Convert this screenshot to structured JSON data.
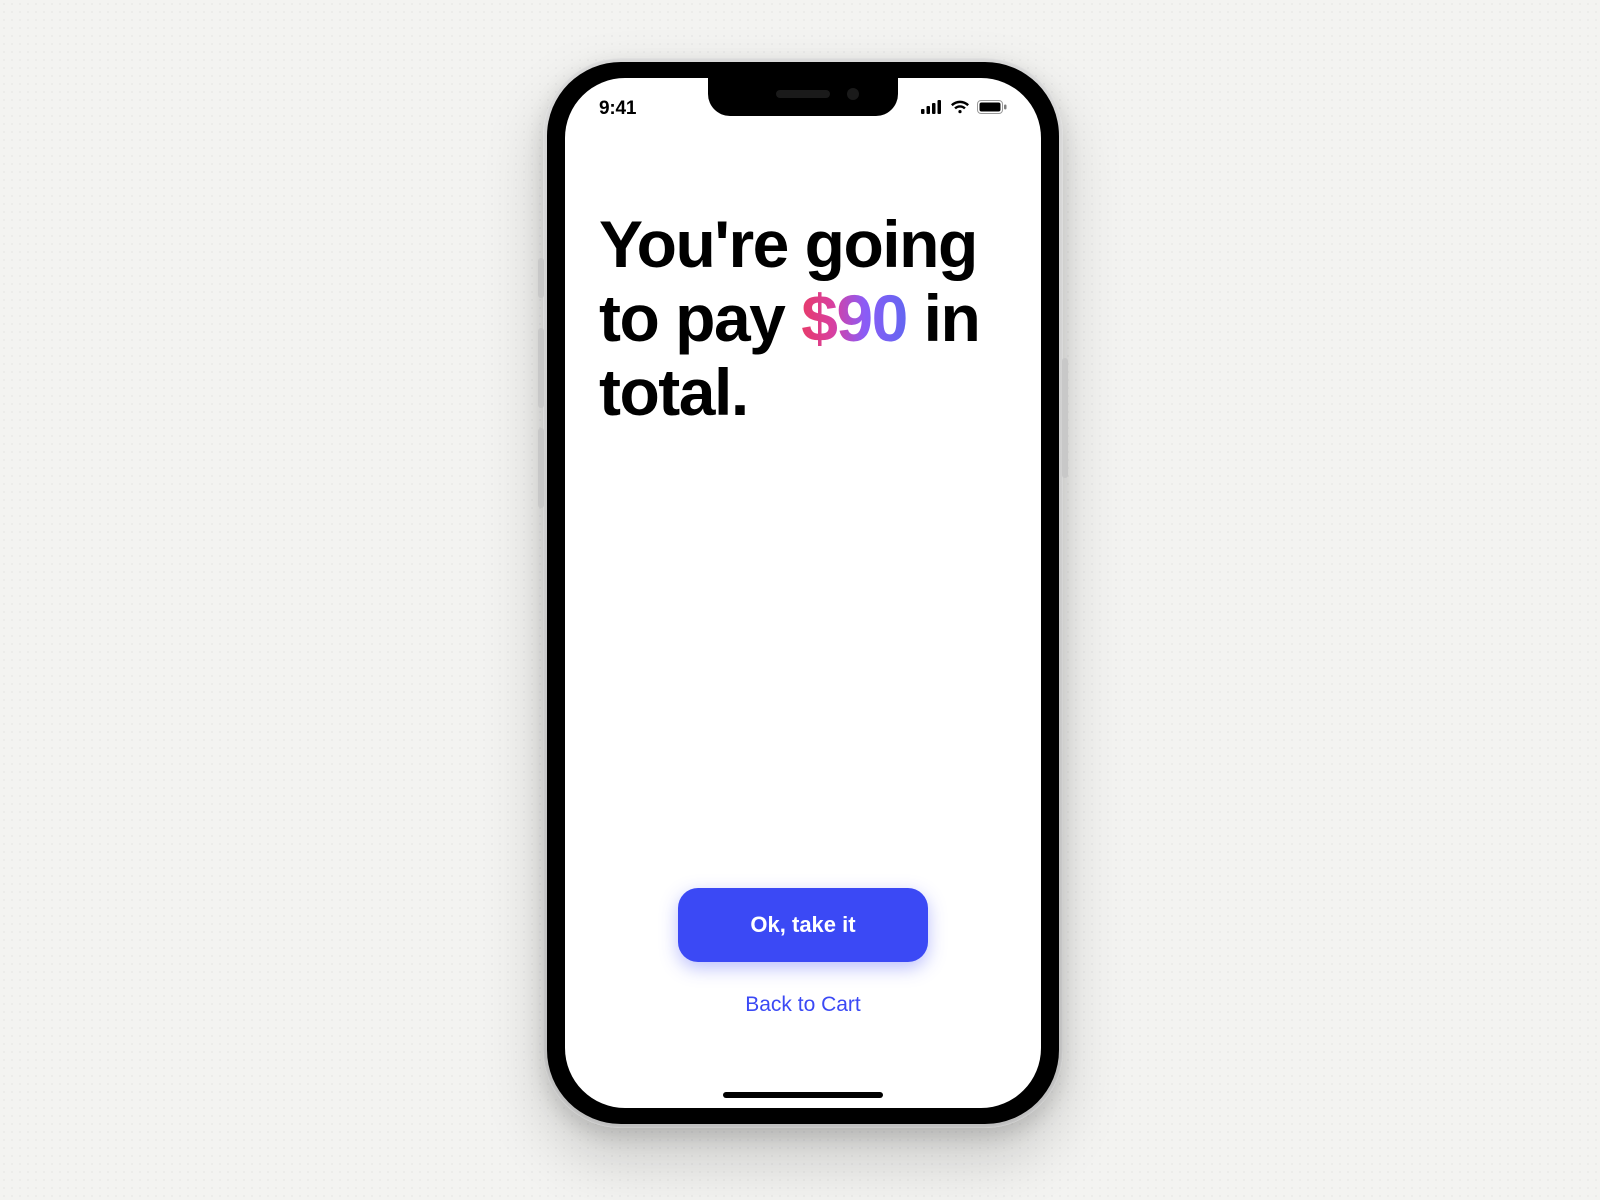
{
  "status": {
    "time": "9:41"
  },
  "headline": {
    "pre": "You're going to pay ",
    "amount": "$90",
    "post": " in total."
  },
  "actions": {
    "primary": "Ok, take it",
    "secondary": "Back to Cart"
  },
  "colors": {
    "primary_button_bg": "#3b49f5",
    "amount_gradient_start": "#e73b6a",
    "amount_gradient_mid": "#8b5cf6",
    "amount_gradient_end": "#6366f1"
  }
}
